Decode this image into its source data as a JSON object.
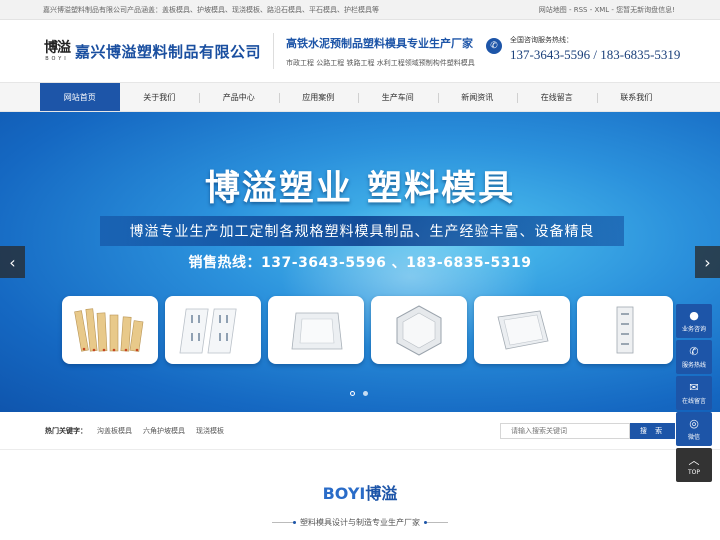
{
  "topbar": {
    "intro": "嘉兴博溢塑料制品有限公司产品涵盖：盖板模具、护坡模具、现浇模板、路沿石模具、平石模具、护栏模具等",
    "links": "网站地图 - RSS - XML - 您暂无新询盘信息!"
  },
  "header": {
    "logo_cn": "博溢",
    "logo_en": "BOYI",
    "company": "嘉兴博溢塑料制品有限公司",
    "slogan": "高铁水泥预制品塑料模具专业生产厂家",
    "slogan_sub": "市政工程 公路工程 铁路工程 水利工程领域预制构件塑料模具",
    "hotline_label": "全国咨询服务热线：",
    "hotline_numbers": "137-3643-5596 / 183-6835-5319"
  },
  "nav": {
    "items": [
      {
        "label": "网站首页",
        "active": true
      },
      {
        "label": "关于我们"
      },
      {
        "label": "产品中心"
      },
      {
        "label": "应用案例"
      },
      {
        "label": "生产车间"
      },
      {
        "label": "新闻资讯"
      },
      {
        "label": "在线留言"
      },
      {
        "label": "联系我们"
      }
    ]
  },
  "banner": {
    "title": "博溢塑业 塑料模具",
    "subtitle": "博溢专业生产加工定制各规格塑料模具制品、生产经验丰富、设备精良",
    "hotline": "销售热线：137-3643-5596 、183-6835-5319",
    "prev_icon": "chevron-left-icon",
    "next_icon": "chevron-right-icon",
    "slides": 2,
    "active_slide": 1
  },
  "keywords": {
    "label": "热门关键字：",
    "items": [
      "沟盖板模具",
      "六角护坡模具",
      "现浇模板"
    ]
  },
  "search": {
    "placeholder": "请输入搜索关键词",
    "button": "搜 索"
  },
  "section": {
    "brand_en": "BOYI",
    "brand_cn": "博溢",
    "subtitle": "塑料模具设计与制造专业生产厂家"
  },
  "float_bar": {
    "items": [
      {
        "label": "业务咨询",
        "icon": "chat-bubble-icon"
      },
      {
        "label": "服务热线",
        "icon": "phone-icon"
      },
      {
        "label": "在线留言",
        "icon": "message-icon"
      },
      {
        "label": "微信",
        "icon": "wechat-icon"
      },
      {
        "label": "TOP",
        "icon": "arrow-up-icon"
      }
    ]
  },
  "colors": {
    "brand_blue": "#1d55a8",
    "banner_light": "#4ec2ef"
  }
}
